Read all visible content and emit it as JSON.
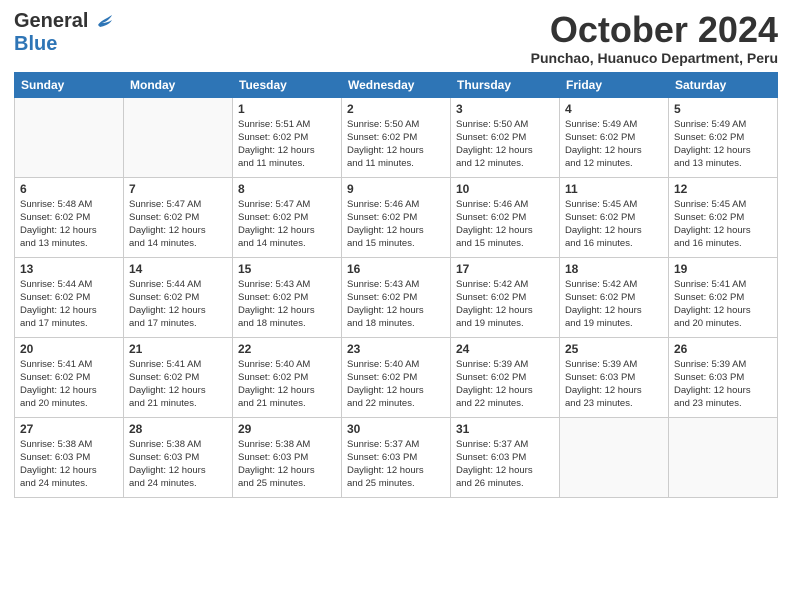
{
  "header": {
    "logo_general": "General",
    "logo_blue": "Blue",
    "month_title": "October 2024",
    "location": "Punchao, Huanuco Department, Peru"
  },
  "days_of_week": [
    "Sunday",
    "Monday",
    "Tuesday",
    "Wednesday",
    "Thursday",
    "Friday",
    "Saturday"
  ],
  "weeks": [
    [
      {
        "day": "",
        "info": ""
      },
      {
        "day": "",
        "info": ""
      },
      {
        "day": "1",
        "info": "Sunrise: 5:51 AM\nSunset: 6:02 PM\nDaylight: 12 hours\nand 11 minutes."
      },
      {
        "day": "2",
        "info": "Sunrise: 5:50 AM\nSunset: 6:02 PM\nDaylight: 12 hours\nand 11 minutes."
      },
      {
        "day": "3",
        "info": "Sunrise: 5:50 AM\nSunset: 6:02 PM\nDaylight: 12 hours\nand 12 minutes."
      },
      {
        "day": "4",
        "info": "Sunrise: 5:49 AM\nSunset: 6:02 PM\nDaylight: 12 hours\nand 12 minutes."
      },
      {
        "day": "5",
        "info": "Sunrise: 5:49 AM\nSunset: 6:02 PM\nDaylight: 12 hours\nand 13 minutes."
      }
    ],
    [
      {
        "day": "6",
        "info": "Sunrise: 5:48 AM\nSunset: 6:02 PM\nDaylight: 12 hours\nand 13 minutes."
      },
      {
        "day": "7",
        "info": "Sunrise: 5:47 AM\nSunset: 6:02 PM\nDaylight: 12 hours\nand 14 minutes."
      },
      {
        "day": "8",
        "info": "Sunrise: 5:47 AM\nSunset: 6:02 PM\nDaylight: 12 hours\nand 14 minutes."
      },
      {
        "day": "9",
        "info": "Sunrise: 5:46 AM\nSunset: 6:02 PM\nDaylight: 12 hours\nand 15 minutes."
      },
      {
        "day": "10",
        "info": "Sunrise: 5:46 AM\nSunset: 6:02 PM\nDaylight: 12 hours\nand 15 minutes."
      },
      {
        "day": "11",
        "info": "Sunrise: 5:45 AM\nSunset: 6:02 PM\nDaylight: 12 hours\nand 16 minutes."
      },
      {
        "day": "12",
        "info": "Sunrise: 5:45 AM\nSunset: 6:02 PM\nDaylight: 12 hours\nand 16 minutes."
      }
    ],
    [
      {
        "day": "13",
        "info": "Sunrise: 5:44 AM\nSunset: 6:02 PM\nDaylight: 12 hours\nand 17 minutes."
      },
      {
        "day": "14",
        "info": "Sunrise: 5:44 AM\nSunset: 6:02 PM\nDaylight: 12 hours\nand 17 minutes."
      },
      {
        "day": "15",
        "info": "Sunrise: 5:43 AM\nSunset: 6:02 PM\nDaylight: 12 hours\nand 18 minutes."
      },
      {
        "day": "16",
        "info": "Sunrise: 5:43 AM\nSunset: 6:02 PM\nDaylight: 12 hours\nand 18 minutes."
      },
      {
        "day": "17",
        "info": "Sunrise: 5:42 AM\nSunset: 6:02 PM\nDaylight: 12 hours\nand 19 minutes."
      },
      {
        "day": "18",
        "info": "Sunrise: 5:42 AM\nSunset: 6:02 PM\nDaylight: 12 hours\nand 19 minutes."
      },
      {
        "day": "19",
        "info": "Sunrise: 5:41 AM\nSunset: 6:02 PM\nDaylight: 12 hours\nand 20 minutes."
      }
    ],
    [
      {
        "day": "20",
        "info": "Sunrise: 5:41 AM\nSunset: 6:02 PM\nDaylight: 12 hours\nand 20 minutes."
      },
      {
        "day": "21",
        "info": "Sunrise: 5:41 AM\nSunset: 6:02 PM\nDaylight: 12 hours\nand 21 minutes."
      },
      {
        "day": "22",
        "info": "Sunrise: 5:40 AM\nSunset: 6:02 PM\nDaylight: 12 hours\nand 21 minutes."
      },
      {
        "day": "23",
        "info": "Sunrise: 5:40 AM\nSunset: 6:02 PM\nDaylight: 12 hours\nand 22 minutes."
      },
      {
        "day": "24",
        "info": "Sunrise: 5:39 AM\nSunset: 6:02 PM\nDaylight: 12 hours\nand 22 minutes."
      },
      {
        "day": "25",
        "info": "Sunrise: 5:39 AM\nSunset: 6:03 PM\nDaylight: 12 hours\nand 23 minutes."
      },
      {
        "day": "26",
        "info": "Sunrise: 5:39 AM\nSunset: 6:03 PM\nDaylight: 12 hours\nand 23 minutes."
      }
    ],
    [
      {
        "day": "27",
        "info": "Sunrise: 5:38 AM\nSunset: 6:03 PM\nDaylight: 12 hours\nand 24 minutes."
      },
      {
        "day": "28",
        "info": "Sunrise: 5:38 AM\nSunset: 6:03 PM\nDaylight: 12 hours\nand 24 minutes."
      },
      {
        "day": "29",
        "info": "Sunrise: 5:38 AM\nSunset: 6:03 PM\nDaylight: 12 hours\nand 25 minutes."
      },
      {
        "day": "30",
        "info": "Sunrise: 5:37 AM\nSunset: 6:03 PM\nDaylight: 12 hours\nand 25 minutes."
      },
      {
        "day": "31",
        "info": "Sunrise: 5:37 AM\nSunset: 6:03 PM\nDaylight: 12 hours\nand 26 minutes."
      },
      {
        "day": "",
        "info": ""
      },
      {
        "day": "",
        "info": ""
      }
    ]
  ]
}
